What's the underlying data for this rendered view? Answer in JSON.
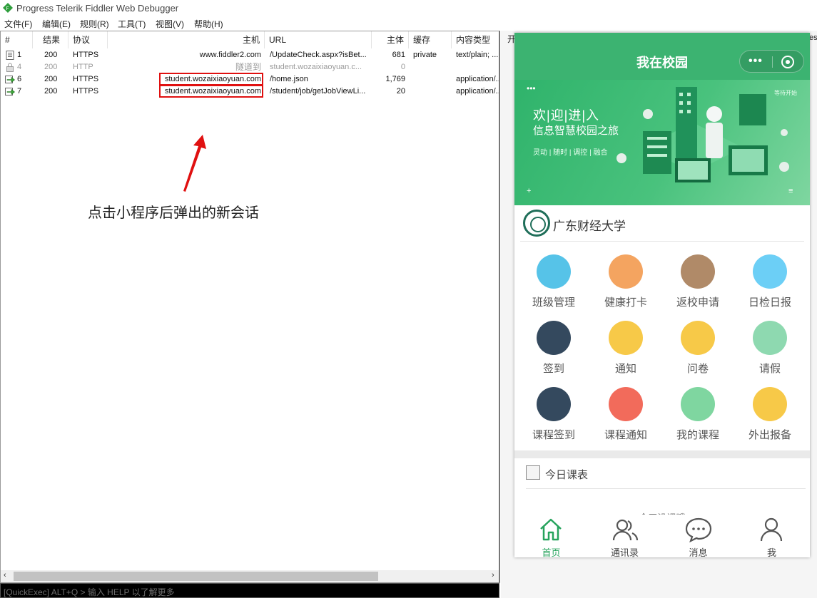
{
  "window": {
    "title": "Progress Telerik Fiddler Web Debugger"
  },
  "menu": [
    "文件(F)",
    "编辑(E)",
    "规则(R)",
    "工具(T)",
    "视图(V)",
    "帮助(H)"
  ],
  "sessions": {
    "columns": [
      "#",
      "结果",
      "协议",
      "主机",
      "URL",
      "主体",
      "缓存",
      "内容类型"
    ],
    "rows": [
      {
        "id": "1",
        "result": "200",
        "protocol": "HTTPS",
        "host": "www.fiddler2.com",
        "url": "/UpdateCheck.aspx?isBet...",
        "body": "681",
        "caching": "private",
        "content_type": "text/plain; ...",
        "icon": "document-icon",
        "dimmed": false,
        "highlighted": false
      },
      {
        "id": "4",
        "result": "200",
        "protocol": "HTTP",
        "host": "隧道到",
        "url": "student.wozaixiaoyuan.c...",
        "body": "0",
        "caching": "",
        "content_type": "",
        "icon": "lock-icon",
        "dimmed": true,
        "highlighted": false
      },
      {
        "id": "6",
        "result": "200",
        "protocol": "HTTPS",
        "host": "student.wozaixiaoyuan.com",
        "url": "/home.json",
        "body": "1,769",
        "caching": "",
        "content_type": "application/...",
        "icon": "json-arrow-icon",
        "dimmed": false,
        "highlighted": true
      },
      {
        "id": "7",
        "result": "200",
        "protocol": "HTTPS",
        "host": "student.wozaixiaoyuan.com",
        "url": "/student/job/getJobViewLi...",
        "body": "20",
        "caching": "",
        "content_type": "application/...",
        "icon": "json-arrow-icon",
        "dimmed": false,
        "highlighted": true
      }
    ]
  },
  "annotation": {
    "text": "点击小程序后弹出的新会话"
  },
  "quickexec": {
    "text": "[QuickExec] ALT+Q > 输入 HELP 以了解更多"
  },
  "right_panel": {
    "tab_text": "开",
    "edge_text": "est"
  },
  "miniapp": {
    "nav_title": "我在校园",
    "capsule_dots": "•••",
    "banner": {
      "line1": "欢|迎|进|入",
      "line2": "信息智慧校园之旅",
      "line3": "灵动 | 随时 | 调控 | 融合",
      "corner": "等待开始",
      "dots": "•••",
      "plus": "+",
      "menu": "≡"
    },
    "school_name": "广东财经大学",
    "grid": [
      {
        "label": "班级管理",
        "color": "#56c3e8",
        "icon": "classroom-icon"
      },
      {
        "label": "健康打卡",
        "color": "#f4a460",
        "icon": "health-clipboard-icon"
      },
      {
        "label": "返校申请",
        "color": "#b08a68",
        "icon": "bus-icon"
      },
      {
        "label": "日检日报",
        "color": "#6ccff6",
        "icon": "thermometer-icon"
      },
      {
        "label": "签到",
        "color": "#34495e",
        "icon": "location-pin-icon"
      },
      {
        "label": "通知",
        "color": "#f7c948",
        "icon": "megaphone-icon"
      },
      {
        "label": "问卷",
        "color": "#f7c948",
        "icon": "survey-icon"
      },
      {
        "label": "请假",
        "color": "#8ed9b0",
        "icon": "leave-form-icon"
      },
      {
        "label": "课程签到",
        "color": "#34495e",
        "icon": "calendar-clock-icon"
      },
      {
        "label": "课程通知",
        "color": "#f26b5b",
        "icon": "teacher-icon"
      },
      {
        "label": "我的课程",
        "color": "#7fd6a0",
        "icon": "blackboard-icon"
      },
      {
        "label": "外出报备",
        "color": "#f7c948",
        "icon": "walker-icon"
      }
    ],
    "schedule": {
      "title": "今日课表",
      "hint": "今天没课哦"
    },
    "tabs": [
      {
        "label": "首页",
        "icon": "home-icon",
        "active": true
      },
      {
        "label": "通讯录",
        "icon": "contacts-icon",
        "active": false
      },
      {
        "label": "消息",
        "icon": "message-icon",
        "active": false
      },
      {
        "label": "我",
        "icon": "user-icon",
        "active": false
      }
    ],
    "colors": {
      "primary": "#3cb371",
      "tab_active": "#27a35d"
    }
  },
  "colors": {
    "highlight_border": "#e01010",
    "annotation_arrow": "#e01010"
  }
}
